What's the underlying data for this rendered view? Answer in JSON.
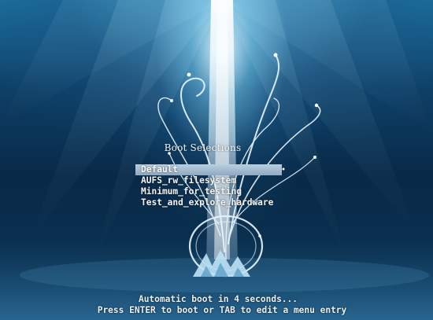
{
  "boot_menu": {
    "title": "Boot Selections",
    "selected_index": 0,
    "entries": [
      {
        "label": "Default"
      },
      {
        "label": "AUFS_rw_filesystem"
      },
      {
        "label": "Minimum_for_testing"
      },
      {
        "label": "Test_and_explore_hardware"
      }
    ]
  },
  "footer": {
    "countdown_text": "Automatic boot in 4 seconds...",
    "instruction_text": "Press ENTER to boot or TAB to edit a menu entry"
  },
  "colors": {
    "selection_bar": "#a6bed3",
    "text": "#f4f7fa",
    "background_deep": "#082a48",
    "light_beam": "#e6f8ff"
  },
  "background": {
    "icon": "underwater-light-swirl-logo-icon"
  }
}
